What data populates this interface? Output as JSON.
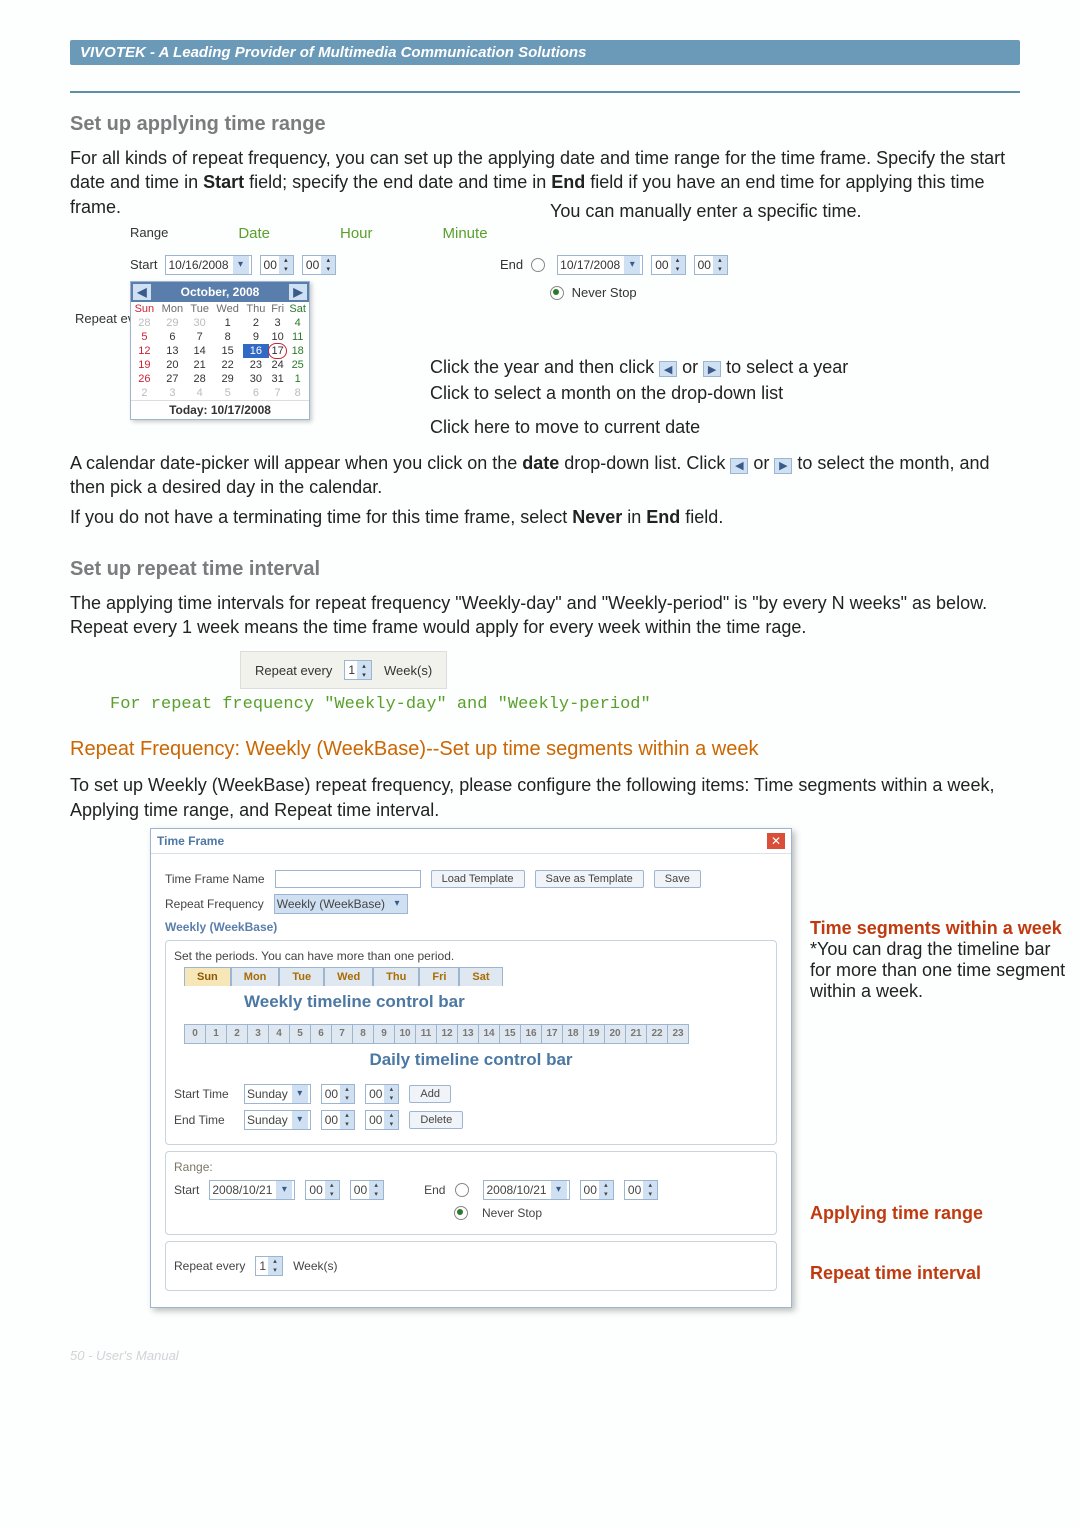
{
  "header": {
    "title": "VIVOTEK - A Leading Provider of Multimedia Communication Solutions"
  },
  "s1": {
    "heading": "Set up applying time range",
    "para": "For all kinds of repeat frequency, you can set up the applying date and time range for the time frame. Specify the start date and time in ",
    "start_bold": "Start",
    "para_mid": " field; specify the end date and time in ",
    "end_bold": "End",
    "para_tail": " field if you have an end time for applying this time frame.",
    "manual_note": "You can manually enter a specific time."
  },
  "range_panel": {
    "labels": {
      "range": "Range",
      "date": "Date",
      "hour": "Hour",
      "minute": "Minute"
    },
    "start_label": "Start",
    "start_date": "10/16/2008",
    "hour_value": "00",
    "minute_value": "00",
    "end_label": "End",
    "end_date": "10/17/2008",
    "end_hour": "00",
    "end_min": "00",
    "never_stop": "Never Stop",
    "repeat_label": "Repeat ev"
  },
  "calendar": {
    "header": "October, 2008",
    "footer": "Today: 10/17/2008",
    "dow": [
      "Sun",
      "Mon",
      "Tue",
      "Wed",
      "Thu",
      "Fri",
      "Sat"
    ],
    "rows": [
      [
        "28",
        "29",
        "30",
        "1",
        "2",
        "3",
        "4"
      ],
      [
        "5",
        "6",
        "7",
        "8",
        "9",
        "10",
        "11"
      ],
      [
        "12",
        "13",
        "14",
        "15",
        "16",
        "17",
        "18"
      ],
      [
        "19",
        "20",
        "21",
        "22",
        "23",
        "24",
        "25"
      ],
      [
        "26",
        "27",
        "28",
        "29",
        "30",
        "31",
        "1"
      ],
      [
        "2",
        "3",
        "4",
        "5",
        "6",
        "7",
        "8"
      ]
    ]
  },
  "annots": {
    "year_a": "Click the year and then click ",
    "year_b": " or ",
    "year_c": " to select a year",
    "month": "Click to select a month on the drop-down list",
    "today": "Click here to move to current date"
  },
  "after_cal_a": "A calendar date-picker will appear when you click on the ",
  "after_cal_bold": "date",
  "after_cal_b": " drop-down list. Click ",
  "after_cal_c": " or ",
  "after_cal_d": " to select the month, and then pick a desired day in the calendar.",
  "after_cal_line2a": "If you do not have a terminating time for this time frame, select ",
  "after_cal_bold2": "Never",
  "after_cal_line2b": " in ",
  "after_cal_bold3": "End",
  "after_cal_line2c": " field.",
  "s2": {
    "heading": "Set up repeat time interval",
    "para": "The applying time intervals for repeat frequency \"Weekly-day\" and \"Weekly-period\" is \"by every N weeks\" as below. Repeat every 1 week means the time frame would apply for every week within the time rage."
  },
  "repeat_box": {
    "label": "Repeat every",
    "value": "1",
    "unit": "Week(s)"
  },
  "repeat_note": "For repeat frequency \"Weekly-day\" and \"Weekly-period\"",
  "s3": {
    "heading": "Repeat Frequency: Weekly (WeekBase)--Set up time segments within a week",
    "para": "To set up Weekly (WeekBase) repeat frequency, please configure the following items: Time segments within a week, Applying time range, and Repeat time interval."
  },
  "dialog": {
    "title": "Time Frame",
    "tfn": "Time Frame Name",
    "load": "Load Template",
    "saveas": "Save as Template",
    "save": "Save",
    "rf": "Repeat Frequency",
    "rf_value": "Weekly (WeekBase)",
    "wk": "Weekly (WeekBase)",
    "instr": "Set the periods. You can have more than one period.",
    "tabs": [
      "Sun",
      "Mon",
      "Tue",
      "Wed",
      "Thu",
      "Fri",
      "Sat"
    ],
    "weekly_bar": "Weekly timeline control bar",
    "daily_bar": "Daily timeline control bar",
    "hours": [
      "0",
      "1",
      "2",
      "3",
      "4",
      "5",
      "6",
      "7",
      "8",
      "9",
      "10",
      "11",
      "12",
      "13",
      "14",
      "15",
      "16",
      "17",
      "18",
      "19",
      "20",
      "21",
      "22",
      "23"
    ],
    "start_time": "Start Time",
    "end_time": "End Time",
    "day_sel": "Sunday",
    "hh": "00",
    "mm": "00",
    "add": "Add",
    "delete": "Delete",
    "range_lbl": "Range:",
    "start": "Start",
    "start_date": "2008/10/21",
    "end": "End",
    "end_date": "2008/10/21",
    "never": "Never Stop",
    "repeat_lbl": "Repeat every",
    "repeat_val": "1",
    "repeat_unit": "Week(s)"
  },
  "callouts": {
    "seg_title": "Time segments within a week",
    "seg_body": "*You can drag the timeline bar for more than one time segment within a week.",
    "apply": "Applying time range",
    "interval": "Repeat time interval"
  },
  "footer": "50 - User's Manual"
}
